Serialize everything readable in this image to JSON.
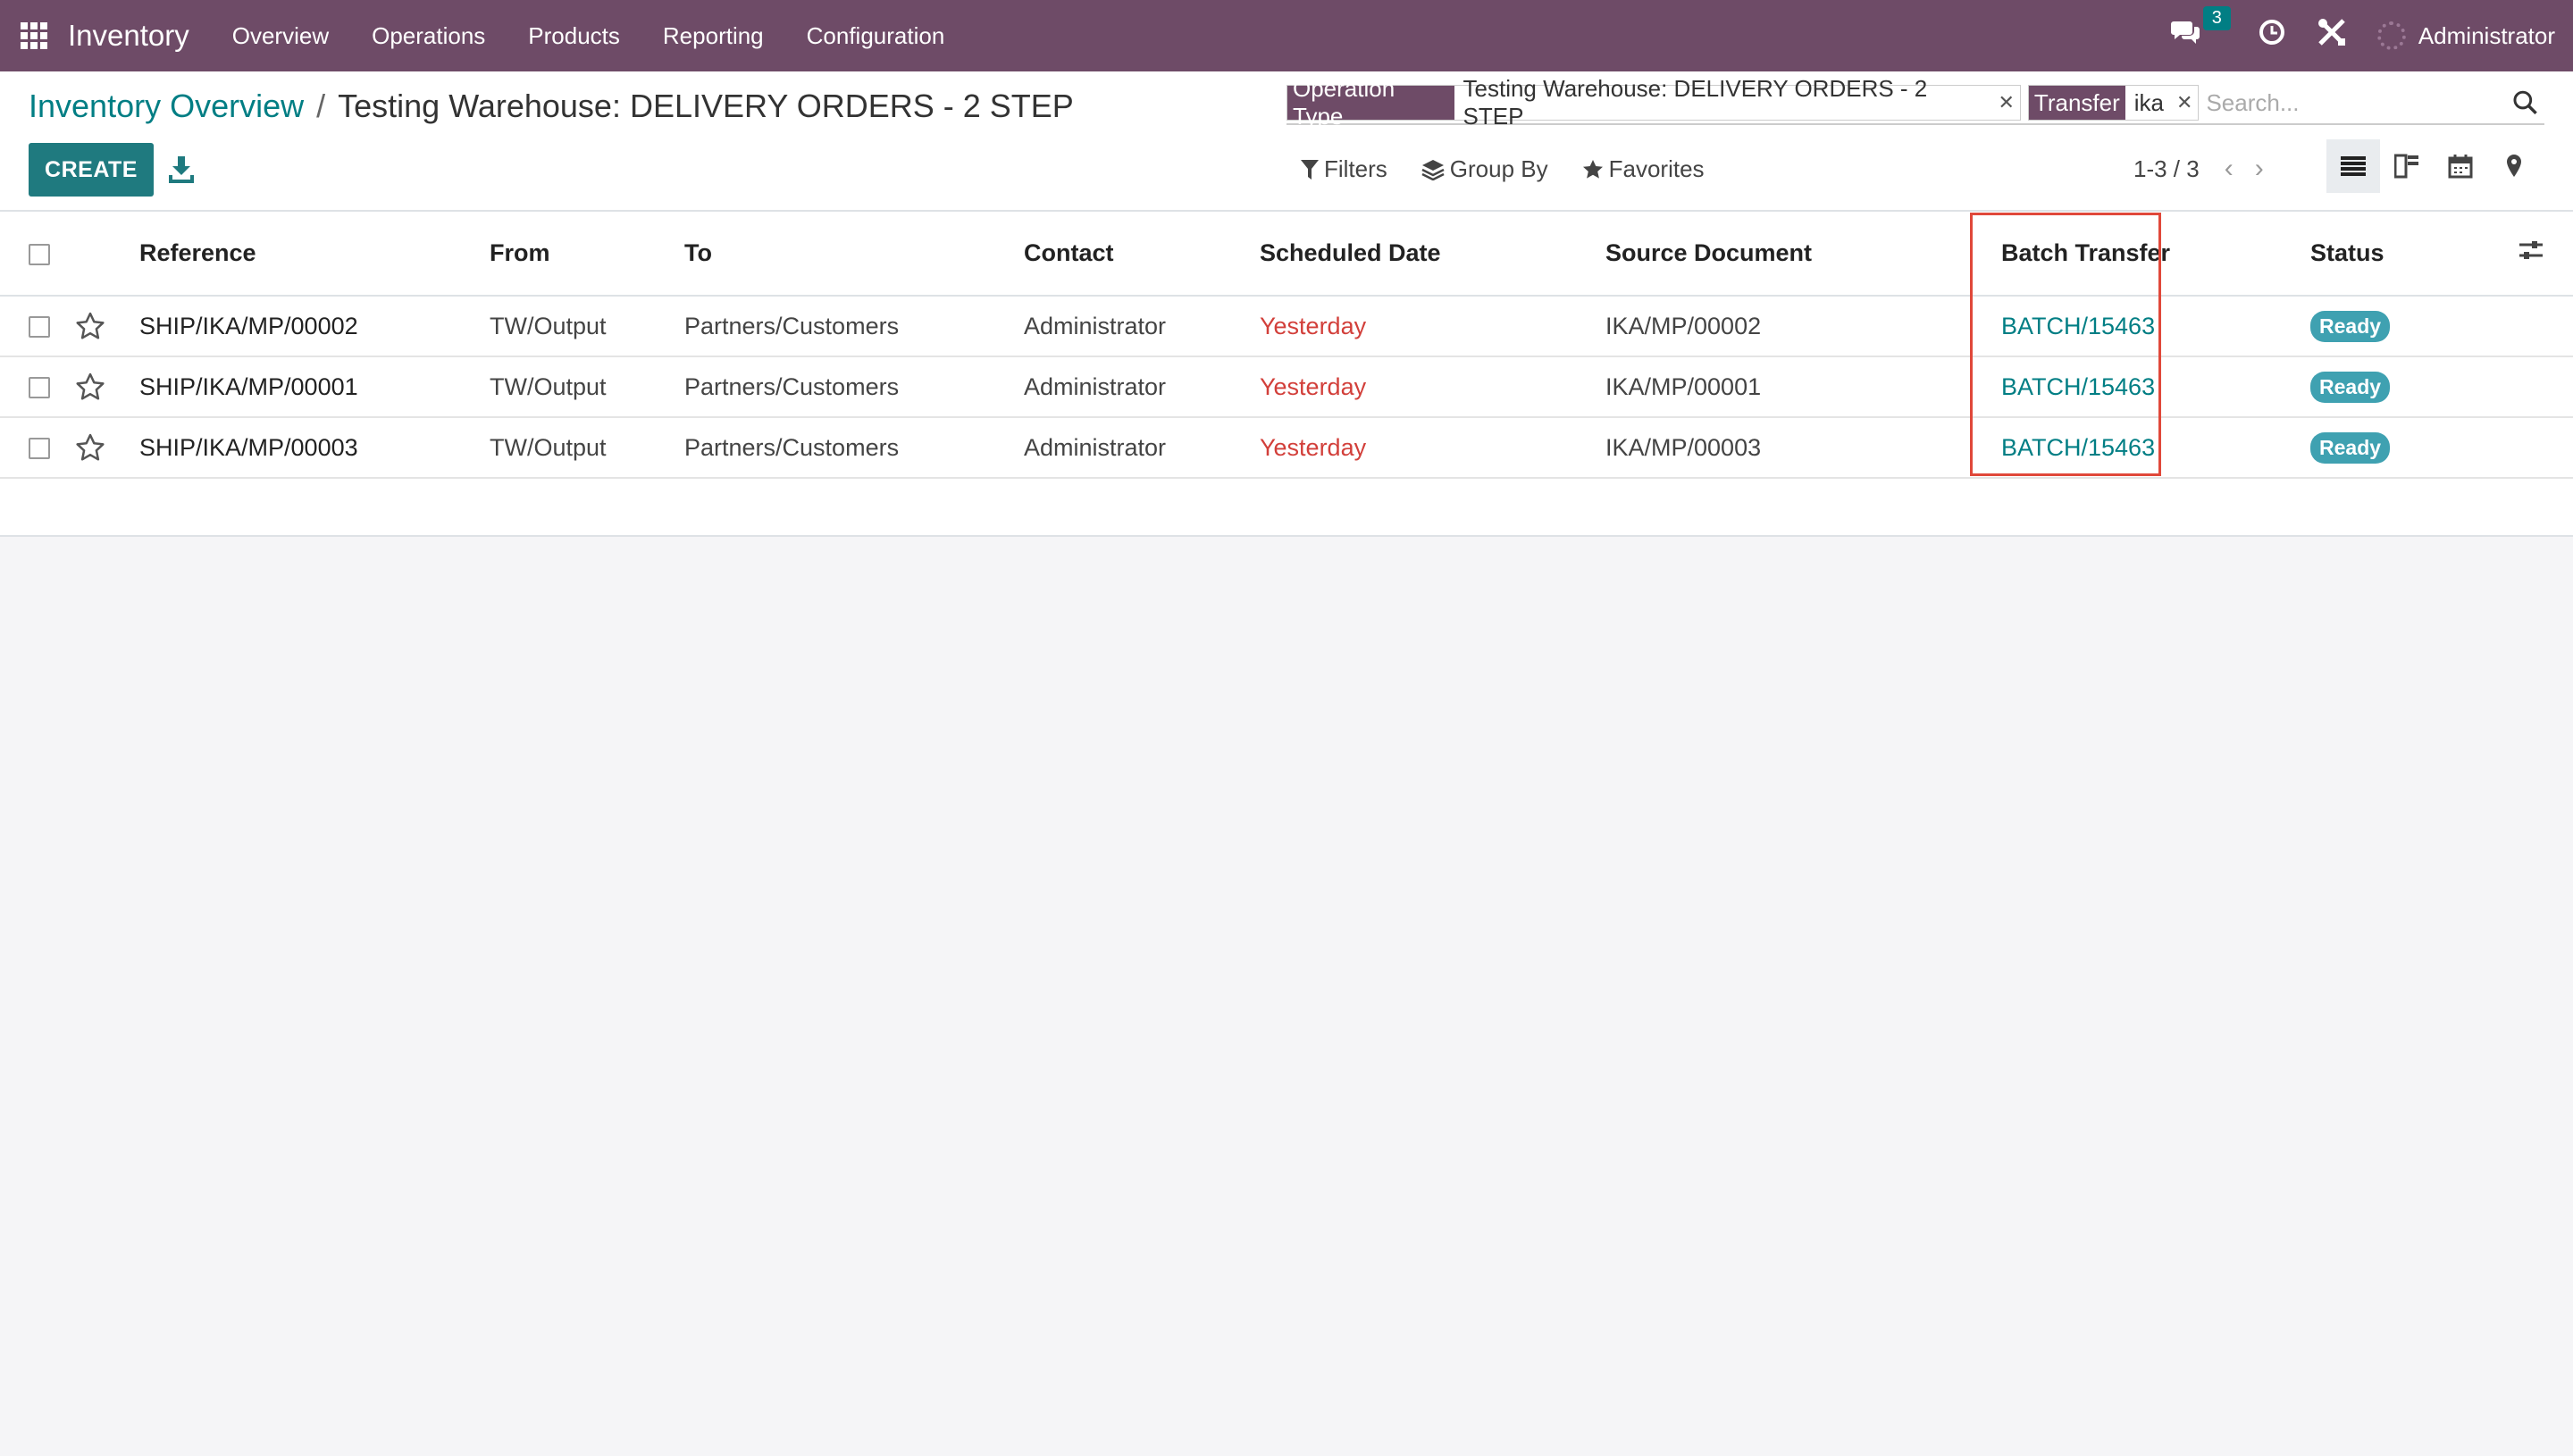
{
  "navbar": {
    "app_name": "Inventory",
    "menu": [
      "Overview",
      "Operations",
      "Products",
      "Reporting",
      "Configuration"
    ],
    "messages_count": "3",
    "user_name": "Administrator"
  },
  "breadcrumb": {
    "parent": "Inventory Overview",
    "separator": "/",
    "current": "Testing Warehouse: DELIVERY ORDERS - 2 STEP"
  },
  "toolbar": {
    "create_label": "CREATE"
  },
  "search": {
    "facets": [
      {
        "label": "Operation Type",
        "value": "Testing Warehouse: DELIVERY ORDERS - 2 STEP"
      },
      {
        "label": "Transfer",
        "value": "ika"
      }
    ],
    "placeholder": "Search..."
  },
  "filters": {
    "filters_label": "Filters",
    "group_by_label": "Group By",
    "favorites_label": "Favorites"
  },
  "pager": {
    "text": "1-3 / 3"
  },
  "table": {
    "columns": [
      "Reference",
      "From",
      "To",
      "Contact",
      "Scheduled Date",
      "Source Document",
      "Batch Transfer",
      "Status"
    ],
    "rows": [
      {
        "reference": "SHIP/IKA/MP/00002",
        "from": "TW/Output",
        "to": "Partners/Customers",
        "contact": "Administrator",
        "scheduled_date": "Yesterday",
        "source": "IKA/MP/00002",
        "batch": "BATCH/15463",
        "status": "Ready"
      },
      {
        "reference": "SHIP/IKA/MP/00001",
        "from": "TW/Output",
        "to": "Partners/Customers",
        "contact": "Administrator",
        "scheduled_date": "Yesterday",
        "source": "IKA/MP/00001",
        "batch": "BATCH/15463",
        "status": "Ready"
      },
      {
        "reference": "SHIP/IKA/MP/00003",
        "from": "TW/Output",
        "to": "Partners/Customers",
        "contact": "Administrator",
        "scheduled_date": "Yesterday",
        "source": "IKA/MP/00003",
        "batch": "BATCH/15463",
        "status": "Ready"
      }
    ]
  },
  "colors": {
    "navbar": "#6e4b67",
    "primary": "#017e84",
    "late_date": "#d23f3a",
    "ready_badge": "#3fa1b1",
    "highlight": "#e0483a"
  }
}
